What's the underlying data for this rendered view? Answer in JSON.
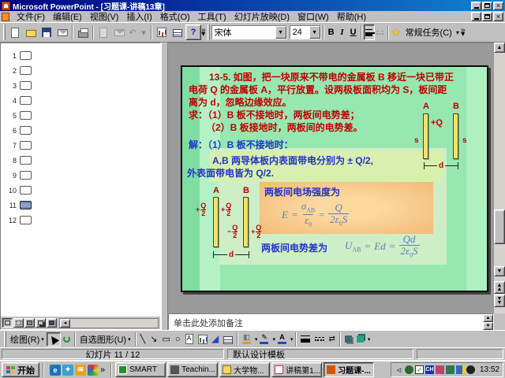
{
  "window": {
    "title": "Microsoft PowerPoint - [习题课-讲稿13章]"
  },
  "menu_bar": {
    "items": [
      "文件(F)",
      "编辑(E)",
      "视图(V)",
      "插入(I)",
      "格式(O)",
      "工具(T)",
      "幻灯片放映(D)",
      "窗口(W)",
      "帮助(H)"
    ]
  },
  "standard_toolbar": {
    "icons": [
      "new",
      "open",
      "save",
      "email",
      "print",
      "copy",
      "paste",
      "undo",
      "insert-chart",
      "insert-table",
      "help"
    ],
    "help_glyph": "?",
    "undo_glyph": "↶",
    "overflow_glyph": "»"
  },
  "formatting_toolbar": {
    "font_name": "宋体",
    "font_size": "24",
    "bold": "B",
    "italic": "I",
    "underline": "U",
    "star_glyph": "★",
    "common_tasks": "常规任务(C)",
    "dropdown_glyph": "▾"
  },
  "outline_pane": {
    "slide_numbers": [
      "1",
      "2",
      "3",
      "4",
      "5",
      "6",
      "7",
      "8",
      "9",
      "10",
      "11",
      "12"
    ],
    "current_slide": "11"
  },
  "slide": {
    "problem": {
      "line1": "13-5. 如图，把一块原来不带电的金属板 B 移近一块已带正",
      "line2": "电荷 Q 的金属板 A，平行放置。设两极板面积均为 S，板间距",
      "line3": "离为 d，忽略边缘效应。",
      "line4": "求：（1）B 板不接地时，两板间电势差；",
      "line5": "（2）B 板接地时，两板间的电势差。"
    },
    "solution": {
      "heading": "解：（1）B 板不接地时：",
      "charge_line1": "A,B 两导体板内表面带电分别为 ± Q/2,",
      "charge_line2": "外表面带电皆为 Q/2.",
      "field_intro": "两板间电场强度为",
      "potential_intro": "两板间电势差为"
    },
    "formula_e": {
      "lhs": "E",
      "eq1": "=",
      "num1_base": "σ",
      "num1_sub": "AB",
      "den1_base": "ε",
      "den1_sub": "0",
      "eq2": "=",
      "num2": "Q",
      "den2_pre": "2ε",
      "den2_sub": "0",
      "den2_post": "S"
    },
    "formula_u": {
      "lhs_base": "U",
      "lhs_sub": "AB",
      "eq1": "=",
      "mid": "Ed",
      "eq2": "=",
      "num": "Qd",
      "den_pre": "2ε",
      "den_sub": "0",
      "den_post": "S"
    },
    "diagram_right": {
      "label_a": "A",
      "label_b": "B",
      "charge": "+Q",
      "area_left": "s",
      "area_right": "s",
      "gap_label": "d"
    },
    "diagram_left": {
      "label_a": "A",
      "label_b": "B",
      "gap_label": "d",
      "charges": [
        {
          "sign": "+",
          "num": "Q",
          "den": "2"
        },
        {
          "sign": "+",
          "num": "Q",
          "den": "2"
        },
        {
          "sign": "−",
          "num": "Q",
          "den": "2"
        },
        {
          "sign": "+",
          "num": "Q",
          "den": "2"
        }
      ]
    }
  },
  "notes_pane": {
    "placeholder": "单击此处添加备注"
  },
  "drawing_toolbar": {
    "draw_label": "绘图(R)",
    "autoshapes_label": "自选图形(U)",
    "line_glyph": "╲",
    "arrow_glyph": "↘",
    "rect_glyph": "▭",
    "oval_glyph": "○",
    "textbox_glyph": "A",
    "wordart_glyph": "◢",
    "arrowstyle_glyph": "⇄"
  },
  "status_bar": {
    "slide_position": "幻灯片 11 / 12",
    "design_template": "默认设计模板"
  },
  "taskbar": {
    "start_label": "开始",
    "quick_launch": [
      "internet-explorer",
      "channels",
      "outlook",
      "media-player"
    ],
    "overflow_glyph": "»",
    "tasks": [
      {
        "label": "SMART"
      },
      {
        "label": "Teachin..."
      },
      {
        "label": "大学物..."
      },
      {
        "label": "讲稿第1..."
      },
      {
        "label": "习题课-..."
      }
    ],
    "input_indicator": "CH",
    "clock": "13:52"
  },
  "colors": {
    "titlebar_start": "#000080",
    "titlebar_end": "#1084d0",
    "slide_background": "#96e8b0",
    "highlight_green": "#d9efae",
    "highlight_orange": "#f3ba78",
    "problem_text": "#c00000",
    "solution_text": "#2233cc",
    "formula_text": "#5f7fb5",
    "plate_fill": "#f2e266"
  }
}
